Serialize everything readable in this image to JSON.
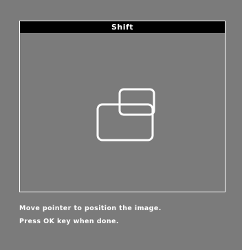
{
  "dialog": {
    "title": "Shift"
  },
  "icon": {
    "name": "image-shift-icon"
  },
  "instructions": {
    "line1": "Move pointer to position the image.",
    "line2": "Press OK key when done."
  },
  "colors": {
    "background": "#7b7b7b",
    "titlebar": "#000000",
    "text": "#ffffff",
    "border": "#ffffff"
  }
}
